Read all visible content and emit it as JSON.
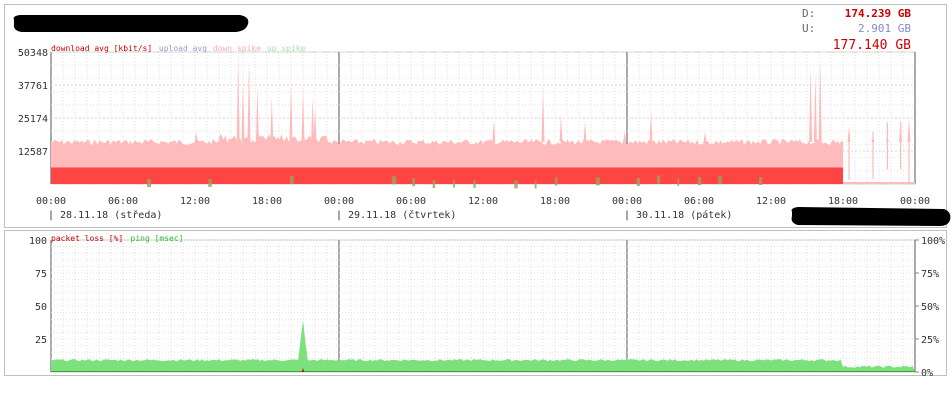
{
  "totals": {
    "down_label": "D:",
    "down_value": "174.239 GB",
    "up_label": "U:",
    "up_value": "2.901 GB",
    "total_value": "177.140 GB"
  },
  "colors": {
    "download": "#ff4444",
    "download_avg": "#ffbbbb",
    "spike": "#ffd0d0",
    "upload": "#9999cc",
    "ping": "#7ce07c",
    "ping_dark": "#40a040",
    "redacted": "#000000"
  },
  "chart_data": [
    {
      "type": "area",
      "legend": [
        {
          "label": "download avg [kbit/s]",
          "color": "#cc0000"
        },
        {
          "label": "upload avg",
          "color": "#9999cc"
        },
        {
          "label": "down spike",
          "color": "#ffaaaa"
        },
        {
          "label": "up spike",
          "color": "#aaddaa"
        }
      ],
      "y_ticks": [
        "50348",
        "37761",
        "25174",
        "12587"
      ],
      "ylim": [
        0,
        50348
      ],
      "x_ticks": [
        "00:00",
        "06:00",
        "12:00",
        "18:00",
        "00:00",
        "06:00",
        "12:00",
        "18:00",
        "00:00",
        "06:00",
        "12:00",
        "18:00",
        "00:00"
      ],
      "day_labels": [
        "| 28.11.18 (středa)",
        "| 29.11.18 (čtvrtek)",
        "| 30.11.18 (pátek)"
      ],
      "download_level_kbits": 6300,
      "download_avg_level_kbits": 16000,
      "download_drop_hour": 66,
      "spikes_kbits": [
        {
          "hour": 12.1,
          "value": 20000
        },
        {
          "hour": 15.6,
          "value": 50000
        },
        {
          "hour": 16.0,
          "value": 40000
        },
        {
          "hour": 16.5,
          "value": 48000
        },
        {
          "hour": 17.2,
          "value": 37000
        },
        {
          "hour": 18.4,
          "value": 33000
        },
        {
          "hour": 20.0,
          "value": 40000
        },
        {
          "hour": 21.0,
          "value": 37000
        },
        {
          "hour": 21.8,
          "value": 33000
        },
        {
          "hour": 22.0,
          "value": 30000
        },
        {
          "hour": 36.9,
          "value": 24000
        },
        {
          "hour": 41.0,
          "value": 37000
        },
        {
          "hour": 42.5,
          "value": 26000
        },
        {
          "hour": 44.5,
          "value": 24000
        },
        {
          "hour": 47.8,
          "value": 20000
        },
        {
          "hour": 50.0,
          "value": 28000
        },
        {
          "hour": 54.5,
          "value": 20000
        },
        {
          "hour": 63.3,
          "value": 45000
        },
        {
          "hour": 63.7,
          "value": 42000
        },
        {
          "hour": 64.1,
          "value": 48000
        },
        {
          "hour": 66.5,
          "value": 22000
        },
        {
          "hour": 68.5,
          "value": 18000
        },
        {
          "hour": 69.7,
          "value": 18000
        },
        {
          "hour": 70.8,
          "value": 25000
        },
        {
          "hour": 71.5,
          "value": 25000
        }
      ]
    },
    {
      "type": "area",
      "legend": [
        {
          "label": "packet loss [%]",
          "color": "#cc0000"
        },
        {
          "label": "ping [msec]",
          "color": "#33bb33"
        }
      ],
      "y_ticks_left": [
        "100",
        "75",
        "50",
        "25"
      ],
      "y_ticks_right": [
        "100%",
        "75%",
        "50%",
        "25%",
        "0%"
      ],
      "ylim": [
        0,
        100
      ],
      "ping_level_msec": 9,
      "ping_level_after_drop_msec": 4,
      "ping_spike": {
        "start_hour": 20.6,
        "end_hour": 21.4,
        "peak_msec": 42
      }
    }
  ]
}
